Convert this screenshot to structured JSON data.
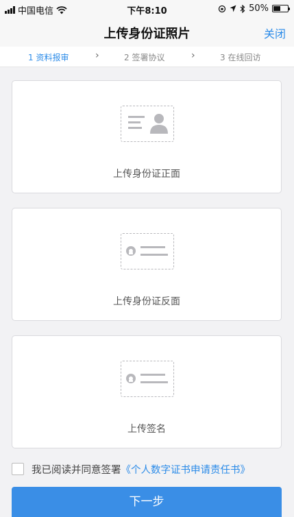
{
  "status_bar": {
    "carrier": "中国电信",
    "time": "下午8:10",
    "battery": "50%"
  },
  "nav": {
    "title": "上传身份证照片",
    "close_label": "关闭"
  },
  "steps": [
    {
      "label": "1 资料报审",
      "active": true
    },
    {
      "label": "2 签署协议",
      "active": false
    },
    {
      "label": "3 在线回访",
      "active": false
    }
  ],
  "step_separator": "›",
  "cards": [
    {
      "label": "上传身份证正面",
      "icon": "id-card-front-icon"
    },
    {
      "label": "上传身份证反面",
      "icon": "id-card-back-icon"
    },
    {
      "label": "上传签名",
      "icon": "signature-icon"
    }
  ],
  "agreement": {
    "text": "我已阅读并同意签署",
    "link": "《个人数字证书申请责任书》"
  },
  "next_button": "下一步",
  "colors": {
    "accent": "#2b8be8",
    "button": "#3a8ee6",
    "background": "#f2f2f4",
    "icon_gray": "#b8b8bc"
  }
}
